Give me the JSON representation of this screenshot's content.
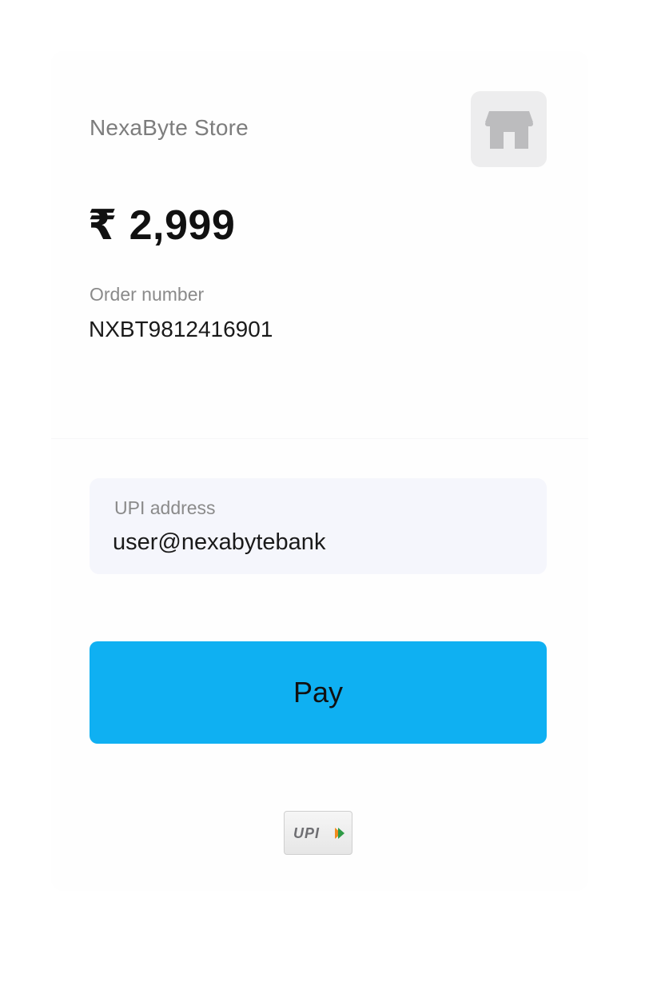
{
  "merchant": {
    "name": "NexaByte Store",
    "icon": "store-icon"
  },
  "payment": {
    "amount": "₹ 2,999",
    "order_label": "Order number",
    "order_number": "NXBT9812416901"
  },
  "upi_field": {
    "label": "UPI address",
    "value": "user@nexabytebank"
  },
  "pay_button": {
    "label": "Pay"
  },
  "footer": {
    "logo_text": "UPI"
  },
  "colors": {
    "accent": "#0fb0f2",
    "field_background": "#f5f6fc",
    "muted_text": "#8a8a8a"
  }
}
